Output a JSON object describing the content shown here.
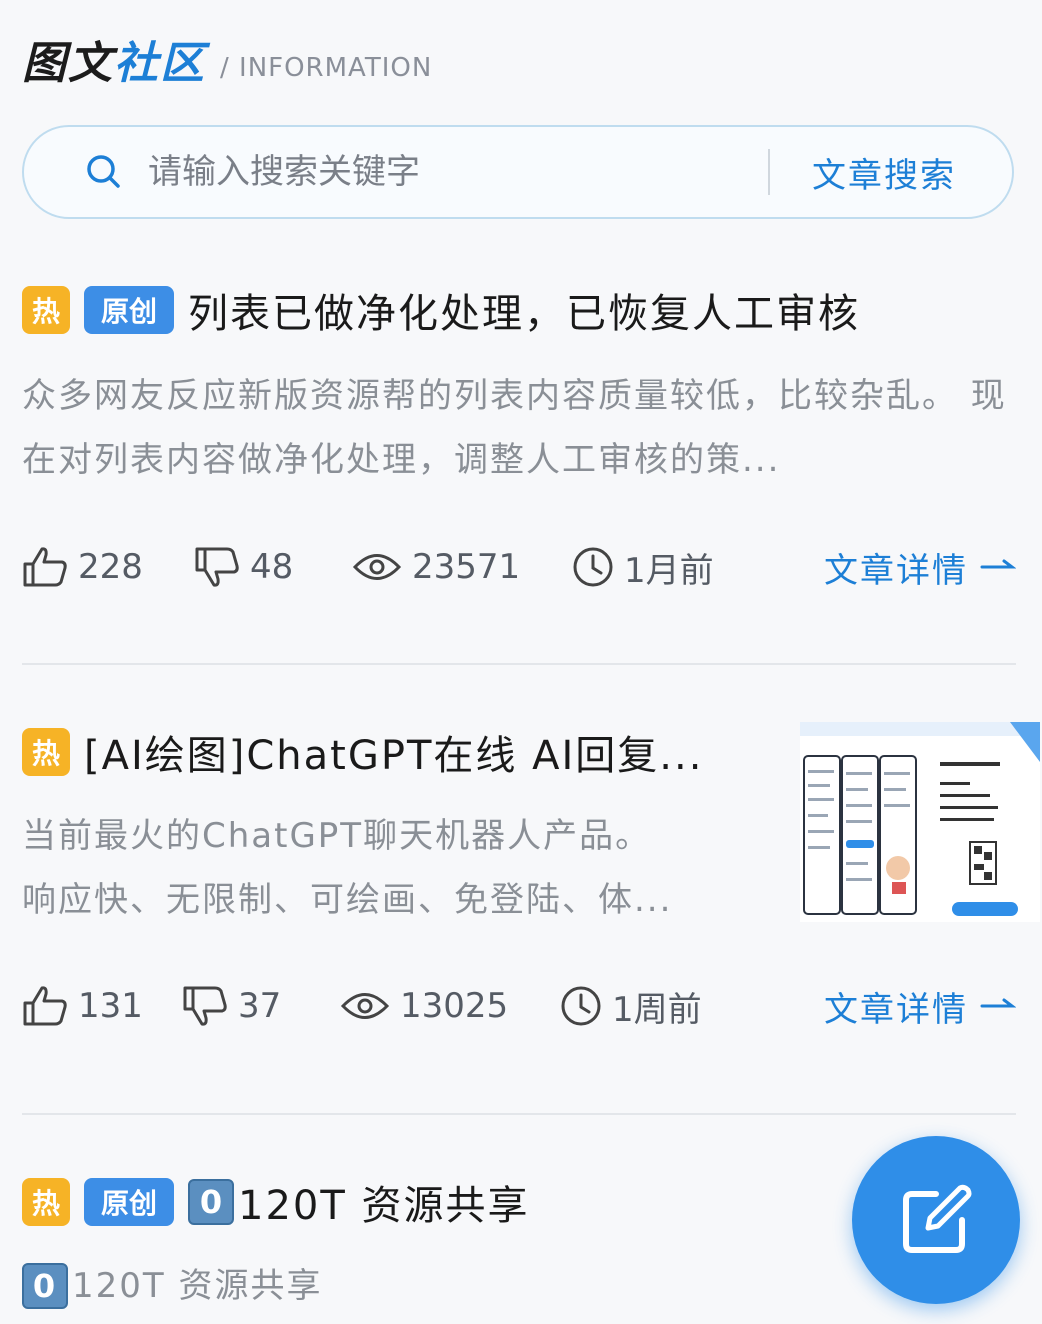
{
  "header": {
    "brand_dark": "图文",
    "brand_blue": "社区",
    "subtitle": "/ INFORMATION"
  },
  "search": {
    "placeholder": "请输入搜索关键字",
    "button_label": "文章搜索"
  },
  "posts": [
    {
      "badges": [
        "热",
        "原创"
      ],
      "title": "列表已做净化处理，已恢复人工审核",
      "desc": "众多网友反应新版资源帮的列表内容质量较低，比较杂乱。 现在对列表内容做净化处理，调整人工审核的策...",
      "likes": "228",
      "dislikes": "48",
      "views": "23571",
      "time": "1月前",
      "detail_label": "文章详情"
    },
    {
      "badges": [
        "热"
      ],
      "title": "[AI绘图]ChatGPT在线 AI回复...",
      "desc_line1": "当前最火的ChatGPT聊天机器人产品。",
      "desc_line2": "响应快、无限制、可绘画、免登陆、体...",
      "likes": "131",
      "dislikes": "37",
      "views": "13025",
      "time": "1周前",
      "detail_label": "文章详情"
    },
    {
      "badges": [
        "热",
        "原创"
      ],
      "num_box": "0",
      "title": "120T 资源共享",
      "desc_num_box": "0",
      "desc": "120T 资源共享"
    }
  ],
  "icons": {
    "search": "search-icon",
    "like": "thumbs-up-icon",
    "dislike": "thumbs-down-icon",
    "views": "eye-icon",
    "time": "clock-icon",
    "arrow": "arrow-right-icon",
    "fab": "edit-icon"
  },
  "colors": {
    "accent": "#1d7fd6",
    "hot_badge": "#f6b326",
    "original_badge": "#3d8ee6",
    "fab": "#2f8ee8"
  }
}
